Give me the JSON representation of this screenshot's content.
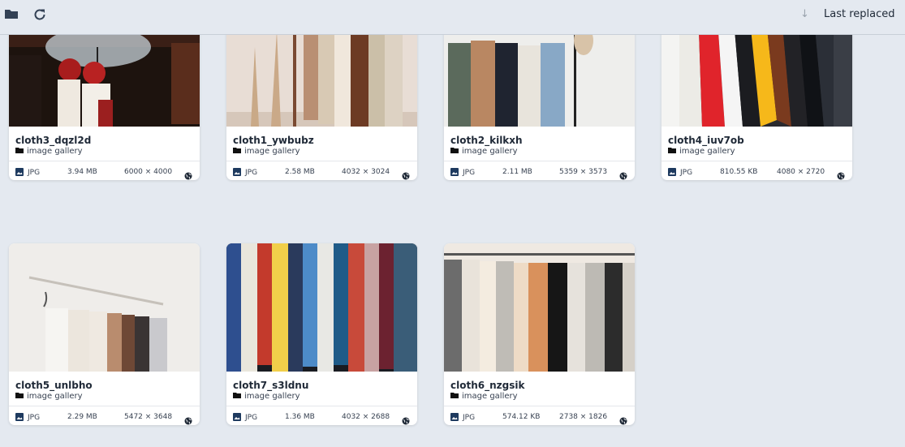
{
  "toolbar": {
    "sort_label": "Last replaced",
    "sort_arrow": "↓"
  },
  "colors": {
    "background": "#e4e9f0",
    "card": "#ffffff",
    "icon": "#334155"
  },
  "icons": [
    "folder-icon",
    "refresh-icon",
    "sort-arrow-icon",
    "image-icon",
    "globe-icon"
  ],
  "cards": [
    {
      "name": "cloth3_dqzl2d",
      "folder": "image gallery",
      "type": "JPG",
      "size": "3.94 MB",
      "dims": "6000 × 4000"
    },
    {
      "name": "cloth1_ywbubz",
      "folder": "image gallery",
      "type": "JPG",
      "size": "2.58 MB",
      "dims": "4032 × 3024"
    },
    {
      "name": "cloth2_kilkxh",
      "folder": "image gallery",
      "type": "JPG",
      "size": "2.11 MB",
      "dims": "5359 × 3573"
    },
    {
      "name": "cloth4_iuv7ob",
      "folder": "image gallery",
      "type": "JPG",
      "size": "810.55 KB",
      "dims": "4080 × 2720"
    },
    {
      "name": "cloth5_unlbho",
      "folder": "image gallery",
      "type": "JPG",
      "size": "2.29 MB",
      "dims": "5472 × 3648"
    },
    {
      "name": "cloth7_s3ldnu",
      "folder": "image gallery",
      "type": "JPG",
      "size": "1.36 MB",
      "dims": "4032 × 2688"
    },
    {
      "name": "cloth6_nzgsik",
      "folder": "image gallery",
      "type": "JPG",
      "size": "574.12 KB",
      "dims": "2738 × 1826"
    }
  ]
}
